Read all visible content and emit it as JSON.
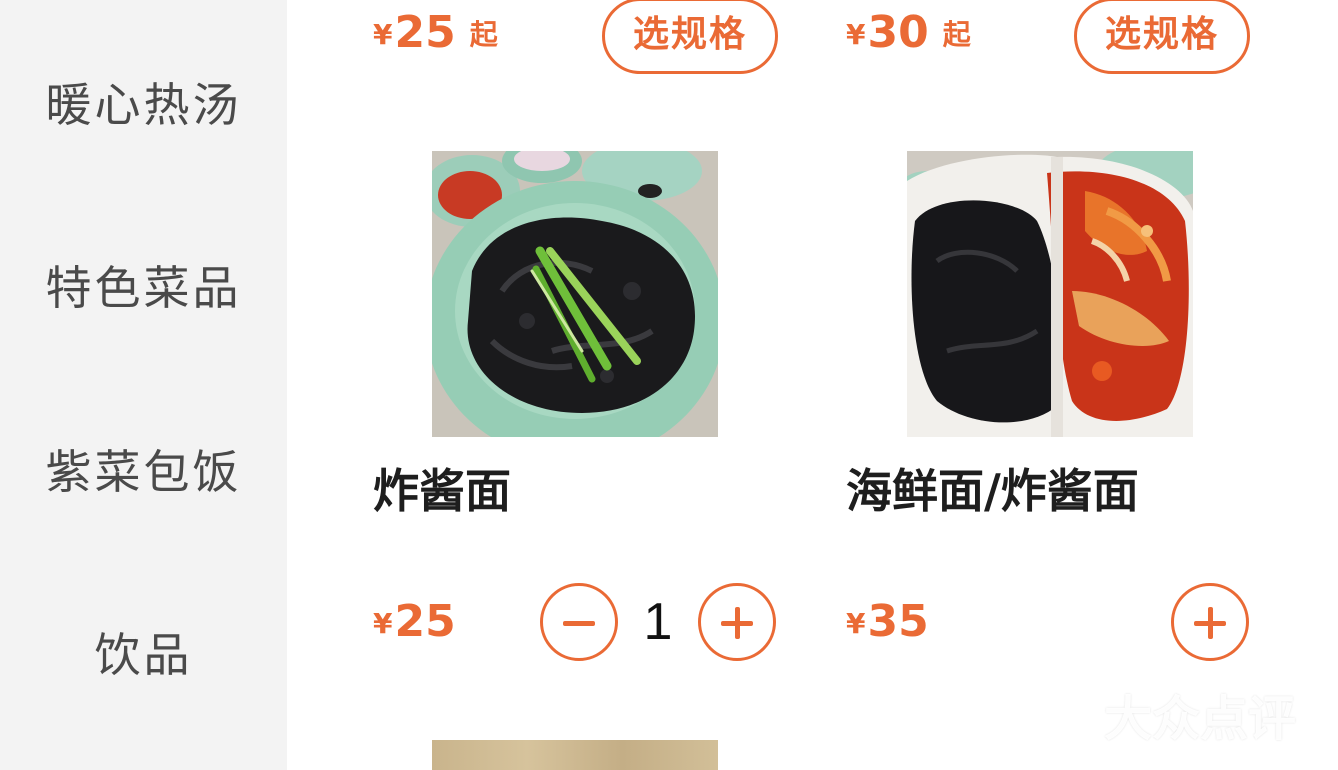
{
  "sidebar": {
    "categories": [
      {
        "label": "暖心热汤"
      },
      {
        "label": "特色菜品"
      },
      {
        "label": "紫菜包饭"
      },
      {
        "label": "饮品"
      }
    ]
  },
  "top_row": [
    {
      "currency": "¥",
      "price": "25",
      "suffix": "起",
      "button_label": "选规格"
    },
    {
      "currency": "¥",
      "price": "30",
      "suffix": "起",
      "button_label": "选规格"
    }
  ],
  "items": [
    {
      "name": "炸酱面",
      "currency": "¥",
      "price": "25",
      "quantity": "1",
      "image_icon": "jajangmyeon-image"
    },
    {
      "name": "海鲜面/炸酱面",
      "currency": "¥",
      "price": "35",
      "image_icon": "seafood-noodle-combo-image"
    }
  ],
  "watermark": {
    "text": "大众点评"
  },
  "colors": {
    "accent": "#ea6a35",
    "sidebar_bg": "#f3f3f3",
    "text_dark": "#1e1e1e",
    "sidebar_text": "#4a4a4a"
  }
}
